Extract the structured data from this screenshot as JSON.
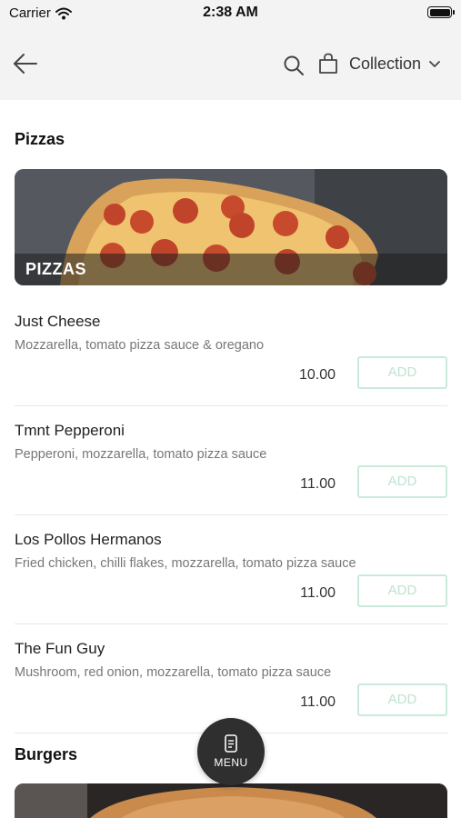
{
  "status_bar": {
    "carrier": "Carrier",
    "time": "2:38 AM",
    "icons": [
      "wifi-icon",
      "battery-icon"
    ]
  },
  "nav": {
    "back_icon": "arrow-left-icon",
    "search_icon": "search-icon",
    "bag_icon": "shopping-bag-icon",
    "collection_label": "Collection",
    "dropdown_icon": "chevron-down-icon"
  },
  "sections": [
    {
      "title": "Pizzas",
      "banner_label": "PIZZAS",
      "items": [
        {
          "name": "Just Cheese",
          "description": "Mozzarella, tomato pizza sauce & oregano",
          "price": "10.00",
          "add_label": "ADD"
        },
        {
          "name": "Tmnt Pepperoni",
          "description": "Pepperoni, mozzarella, tomato pizza sauce",
          "price": "11.00",
          "add_label": "ADD"
        },
        {
          "name": "Los Pollos Hermanos",
          "description": "Fried chicken, chilli flakes, mozzarella, tomato pizza sauce",
          "price": "11.00",
          "add_label": "ADD"
        },
        {
          "name": "The Fun Guy",
          "description": "Mushroom, red onion, mozzarella, tomato pizza sauce",
          "price": "11.00",
          "add_label": "ADD"
        }
      ]
    },
    {
      "title": "Burgers",
      "items": []
    }
  ],
  "fab": {
    "label": "MENU",
    "icon": "menu-card-icon"
  },
  "colors": {
    "header_bg": "#f3f3f3",
    "add_border": "#c9ead9",
    "add_text": "#bfe3d0",
    "fab_bg": "#2f2f2f"
  }
}
